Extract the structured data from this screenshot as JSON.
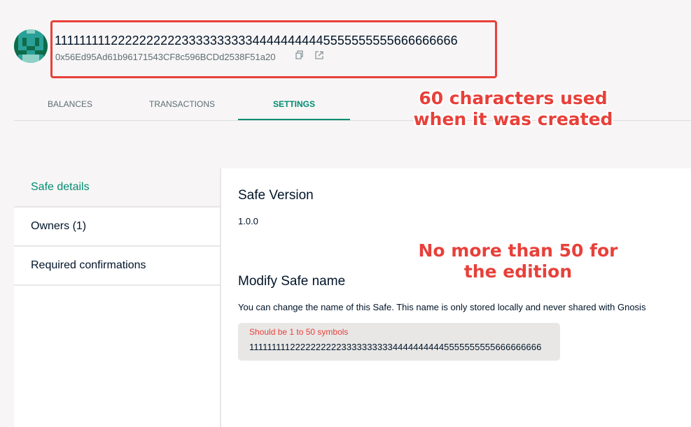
{
  "header": {
    "safe_name": "1111111112222222222333333333344444444445555555555666666666",
    "safe_address": "0x56Ed95Ad61b96171543CF8c596BCDd2538F51a20",
    "icons": [
      "identicon-avatar",
      "copy-icon",
      "external-link-icon"
    ]
  },
  "tabs": [
    {
      "label": "BALANCES"
    },
    {
      "label": "TRANSACTIONS"
    },
    {
      "label": "SETTINGS",
      "active": true
    }
  ],
  "annotations": {
    "created_note": [
      "60 characters used",
      "when it was created"
    ],
    "edition_note": [
      "No more than 50 for",
      "the edition"
    ]
  },
  "settings_menu": {
    "items": [
      {
        "label": "Safe details",
        "active": true
      },
      {
        "label": "Owners (1)"
      },
      {
        "label": "Required confirmations"
      }
    ]
  },
  "safe_details": {
    "version_title": "Safe Version",
    "version_value": "1.0.0",
    "modify_title": "Modify Safe name",
    "modify_description": "You can change the name of this Safe. This name is only stored locally and never shared with Gnosis",
    "name_field": {
      "error": "Should be 1 to 50 symbols",
      "value": "1111111112222222222333333333344444444445555555555666666666"
    }
  },
  "colors": {
    "accent": "#008c73",
    "error": "#e8403a",
    "background": "#f7f5f5",
    "text": "#001428",
    "secondary_text": "#5d6d74"
  }
}
